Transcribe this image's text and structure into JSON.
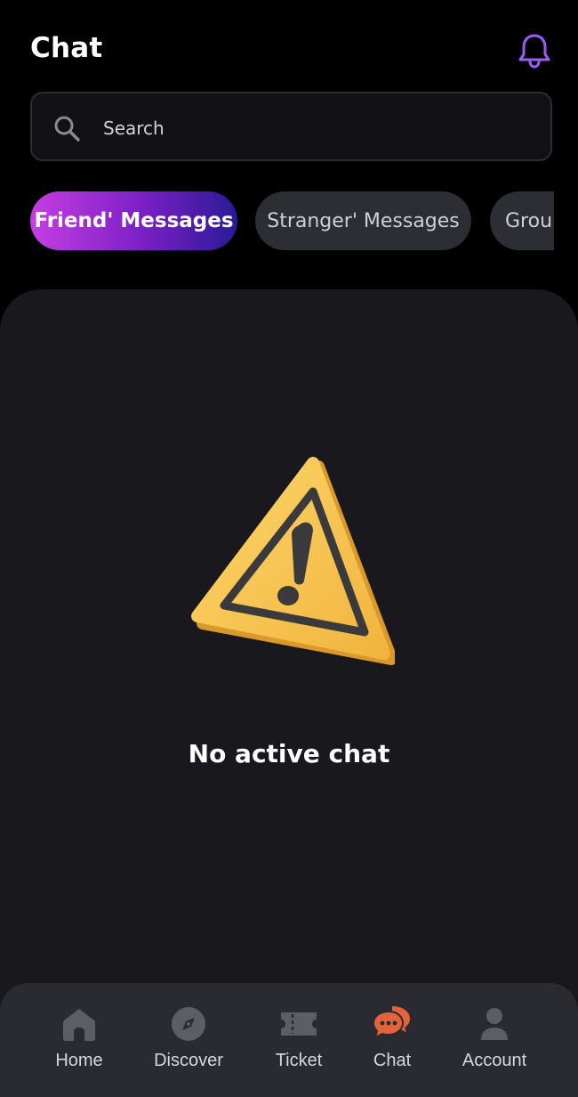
{
  "header": {
    "title": "Chat",
    "notification_icon": "bell-icon"
  },
  "search": {
    "placeholder": "Search",
    "icon": "search-icon"
  },
  "tabs": [
    {
      "label": "Friend' Messages",
      "active": true
    },
    {
      "label": "Stranger' Messages",
      "active": false
    },
    {
      "label": "Group",
      "active": false
    }
  ],
  "empty_state": {
    "icon": "warning-icon",
    "message": "No active chat"
  },
  "bottom_nav": {
    "items": [
      {
        "label": "Home",
        "icon": "home-icon",
        "active": false
      },
      {
        "label": "Discover",
        "icon": "compass-icon",
        "active": false
      },
      {
        "label": "Ticket",
        "icon": "ticket-icon",
        "active": false
      },
      {
        "label": "Chat",
        "icon": "chat-bubble-icon",
        "active": true
      },
      {
        "label": "Account",
        "icon": "user-icon",
        "active": false
      }
    ]
  },
  "colors": {
    "background": "#000000",
    "panel": "#18181d",
    "nav_background": "#2a2a31",
    "accent_purple": "#9b5cf6",
    "active_tab_gradient_start": "#c53ee3",
    "active_tab_gradient_end": "#2a1a96",
    "active_nav_icon": "#e2643a",
    "inactive_nav_icon": "#5d5d66",
    "warning_yellow": "#f7c552"
  }
}
